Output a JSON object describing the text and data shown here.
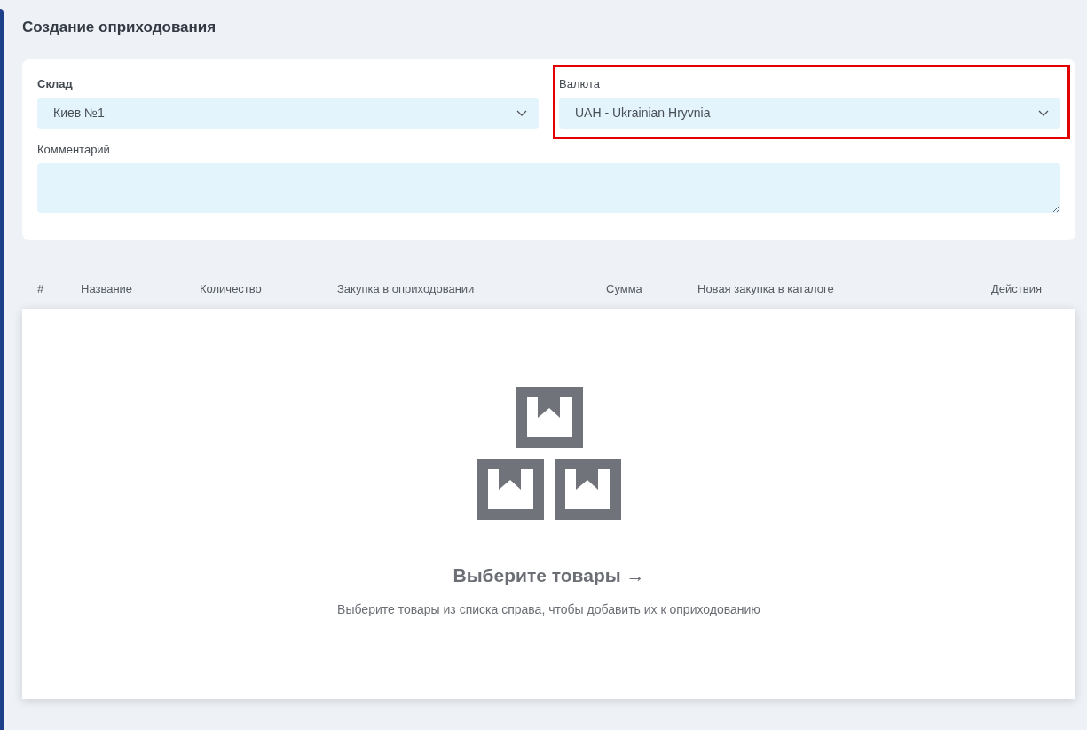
{
  "page": {
    "title": "Создание оприходования"
  },
  "form": {
    "fields": [
      {
        "kind": "select",
        "label": "Склад",
        "label_bold": true,
        "value": "Киев №1",
        "highlighted": false
      },
      {
        "kind": "select",
        "label": "Валюта",
        "label_bold": false,
        "value": "UAH - Ukrainian Hryvnia",
        "highlighted": true
      },
      {
        "kind": "textarea",
        "label": "Комментарий",
        "label_bold": false,
        "highlighted": false
      }
    ]
  },
  "table": {
    "columns": [
      "#",
      "Название",
      "Количество",
      "Закупка в оприходовании",
      "Сумма",
      "Новая закупка в каталоге",
      "Действия"
    ]
  },
  "empty_state": {
    "title": "Выберите товары →",
    "message": "Выберите товары из списка справа, чтобы добавить их к оприходованию"
  }
}
